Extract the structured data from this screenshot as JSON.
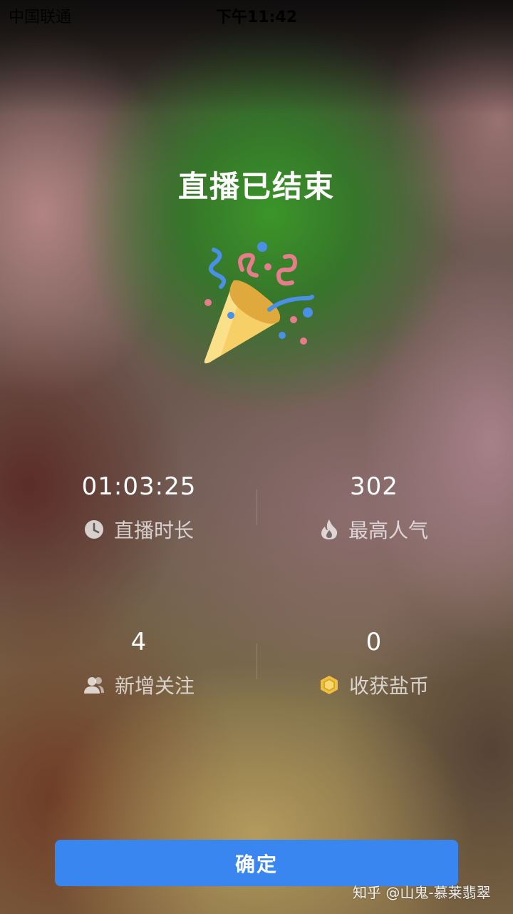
{
  "status_bar": {
    "carrier": "中国联通",
    "time": "下午11:42"
  },
  "page": {
    "title": "直播已结束"
  },
  "stats": [
    {
      "value": "01:03:25",
      "label": "直播时长",
      "icon": "clock-icon"
    },
    {
      "value": "302",
      "label": "最高人气",
      "icon": "flame-icon"
    },
    {
      "value": "4",
      "label": "新增关注",
      "icon": "users-icon"
    },
    {
      "value": "0",
      "label": "收获盐币",
      "icon": "coin-icon"
    }
  ],
  "confirm_button": {
    "label": "确定"
  },
  "watermark": "知乎 @山鬼-慕莱翡翠",
  "colors": {
    "accent": "#3a86f0",
    "coin": "#f0c040"
  }
}
